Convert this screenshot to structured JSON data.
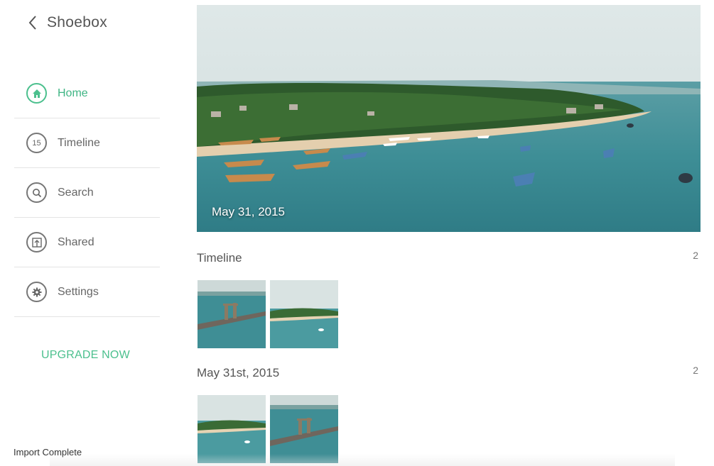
{
  "app": {
    "title": "Shoebox"
  },
  "sidebar": {
    "items": [
      {
        "label": "Home",
        "icon": "home-icon",
        "active": true
      },
      {
        "label": "Timeline",
        "icon": "timeline-icon",
        "badge": "15"
      },
      {
        "label": "Search",
        "icon": "search-icon"
      },
      {
        "label": "Shared",
        "icon": "share-icon"
      },
      {
        "label": "Settings",
        "icon": "gear-icon"
      }
    ],
    "upgrade": "UPGRADE NOW",
    "status": "Import Complete"
  },
  "hero": {
    "date": "May 31, 2015"
  },
  "sections": [
    {
      "title": "Timeline",
      "count": "2"
    },
    {
      "title": "May 31st, 2015",
      "count": "2"
    }
  ],
  "colors": {
    "accent": "#4cc08e",
    "text": "#555555",
    "divider": "#e4e4e4"
  }
}
